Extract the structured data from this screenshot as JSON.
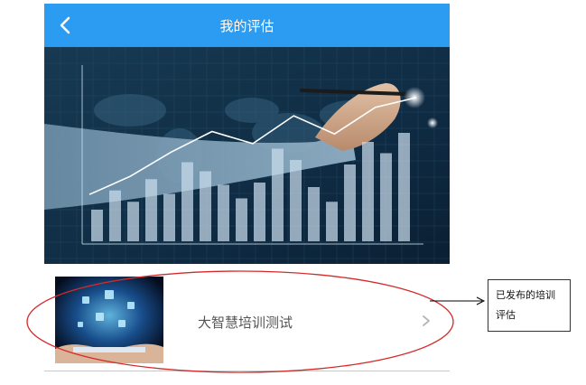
{
  "header": {
    "title": "我的评估",
    "back_icon": "chevron-left-icon"
  },
  "hero": {
    "image": "business-chart-banner",
    "bars": [
      0.28,
      0.45,
      0.35,
      0.55,
      0.42,
      0.7,
      0.62,
      0.5,
      0.38,
      0.52,
      0.82,
      0.72,
      0.48,
      0.35,
      0.68,
      0.88,
      0.78,
      0.96
    ],
    "line": [
      0.2,
      0.35,
      0.55,
      0.72,
      0.62,
      0.85,
      0.7,
      0.92,
      1.0
    ]
  },
  "list": [
    {
      "title": "大智慧培训测试",
      "thumb": "tablet-hologram-thumbnail"
    }
  ],
  "annotation": {
    "callout_text": "已发布的培训评估"
  },
  "colors": {
    "header_bg": "#2b9cf2",
    "annotation_red": "#d42a2a"
  }
}
